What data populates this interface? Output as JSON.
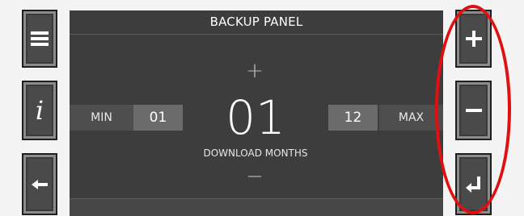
{
  "panel": {
    "title": "BACKUP PANEL",
    "min_label": "MIN",
    "min_value": "01",
    "max_label": "MAX",
    "max_value": "12",
    "current_value": "01",
    "caption": "DOWNLOAD MONTHS",
    "increase_mark": "+",
    "decrease_mark": "−"
  },
  "left_buttons": [
    {
      "name": "menu",
      "icon": "menu-icon"
    },
    {
      "name": "info",
      "icon": "info-icon",
      "glyph": "i"
    },
    {
      "name": "back",
      "icon": "arrow-left-icon"
    }
  ],
  "right_buttons": [
    {
      "name": "increase",
      "icon": "plus-icon"
    },
    {
      "name": "decrease",
      "icon": "minus-icon"
    },
    {
      "name": "enter",
      "icon": "enter-return-icon"
    }
  ],
  "colors": {
    "background": "#f4f4f4",
    "panel": "#3d3d3d",
    "button_face": "#4a4a4a",
    "value_box": "#6b6b6b",
    "highlight": "#e01010"
  }
}
